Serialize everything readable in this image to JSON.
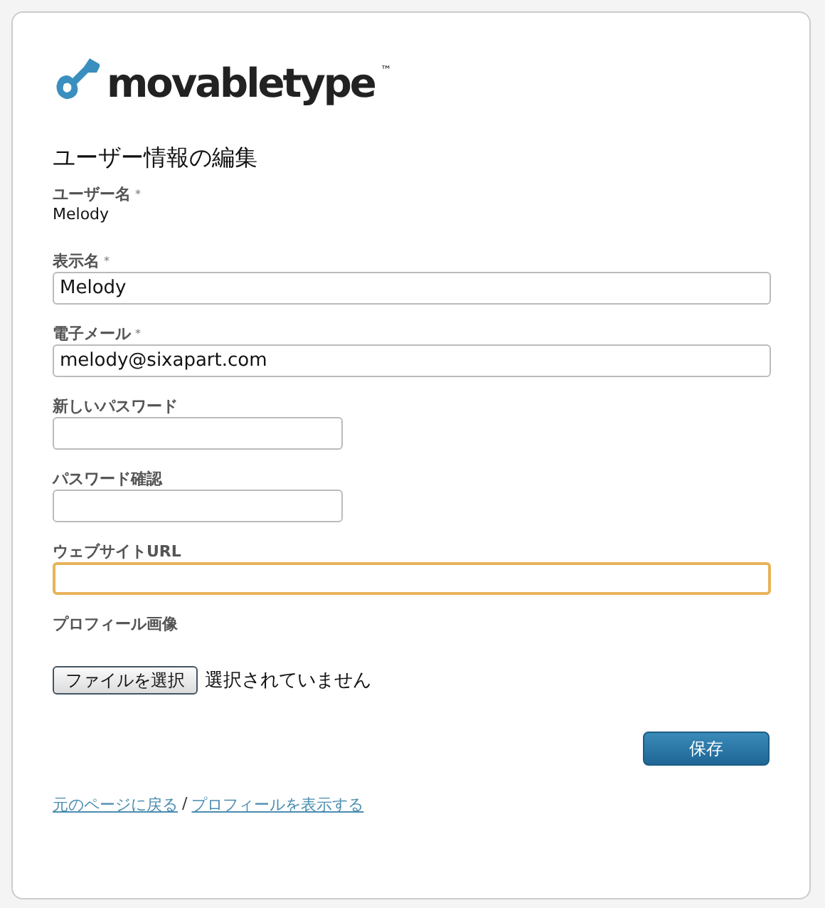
{
  "logo": {
    "text": "movabletype",
    "trademark": "™"
  },
  "heading": "ユーザー情報の編集",
  "fields": [
    {
      "kind": "static",
      "label": "ユーザー名",
      "mark": "*",
      "value": "Melody"
    },
    {
      "kind": "text",
      "label": "表示名",
      "mark": "*",
      "value": "Melody",
      "focused": false,
      "wide": true
    },
    {
      "kind": "text",
      "label": "電子メール",
      "mark": "*",
      "value": "melody@sixapart.com",
      "focused": false,
      "wide": true
    },
    {
      "kind": "password",
      "label": "新しいパスワード",
      "focused": false,
      "wide": false
    },
    {
      "kind": "password",
      "label": "パスワード確認",
      "focused": false,
      "wide": false
    },
    {
      "kind": "text",
      "label": "ウェブサイトURL",
      "focused": true,
      "wide": true
    },
    {
      "kind": "file",
      "label": "プロフィール画像",
      "button": "ファイルを選択",
      "status": "選択されていません"
    }
  ],
  "save_button": "保存",
  "links": [
    {
      "text": "元のページに戻る"
    },
    {
      "text": "プロフィールを表示する"
    }
  ],
  "link_separator": "/"
}
